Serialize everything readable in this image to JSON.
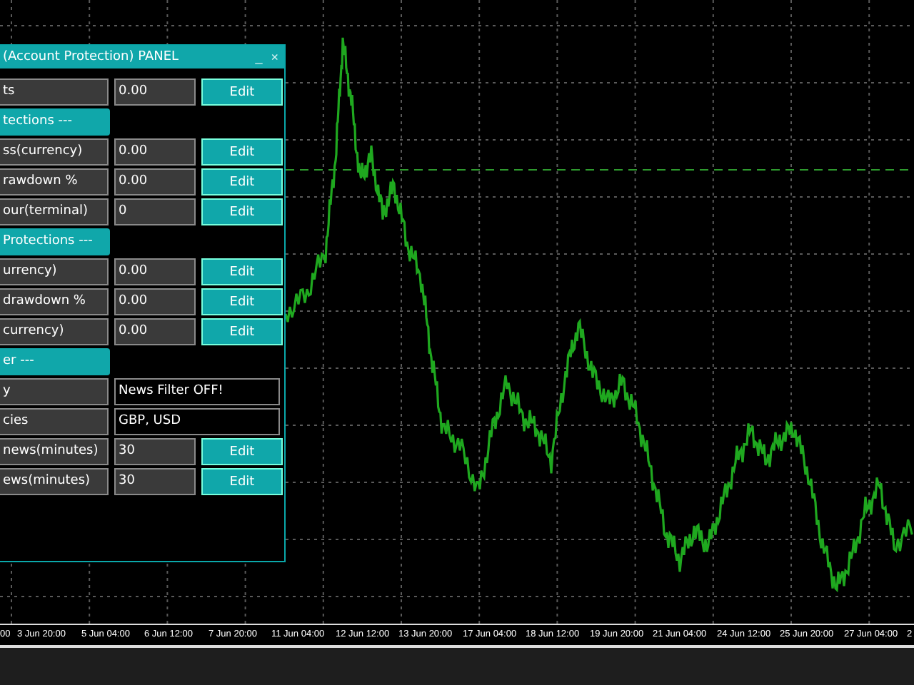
{
  "panel": {
    "title": "(Account Protection) PANEL",
    "minimize": "_",
    "close": "×",
    "rows": [
      {
        "kind": "edit",
        "label": "ts",
        "value": "0.00",
        "button": "Edit"
      },
      {
        "kind": "header",
        "label": "tections ---"
      },
      {
        "kind": "edit",
        "label": "ss(currency)",
        "value": "0.00",
        "button": "Edit"
      },
      {
        "kind": "edit",
        "label": "rawdown %",
        "value": "0.00",
        "button": "Edit"
      },
      {
        "kind": "edit",
        "label": "our(terminal)",
        "value": "0",
        "button": "Edit"
      },
      {
        "kind": "header",
        "label": "Protections ---"
      },
      {
        "kind": "edit",
        "label": "urrency)",
        "value": "0.00",
        "button": "Edit"
      },
      {
        "kind": "edit",
        "label": "drawdown %",
        "value": "0.00",
        "button": "Edit"
      },
      {
        "kind": "edit",
        "label": "currency)",
        "value": "0.00",
        "button": "Edit"
      },
      {
        "kind": "header",
        "label": "er ---"
      },
      {
        "kind": "text",
        "label": "y",
        "value": "News Filter OFF!"
      },
      {
        "kind": "text",
        "label": "cies",
        "value": "GBP, USD"
      },
      {
        "kind": "edit",
        "label": "news(minutes)",
        "value": "30",
        "button": "Edit"
      },
      {
        "kind": "edit",
        "label": "ews(minutes)",
        "value": "30",
        "button": "Edit"
      }
    ]
  },
  "time_axis": [
    "00",
    "3 Jun 20:00",
    "5 Jun 04:00",
    "6 Jun 12:00",
    "7 Jun 20:00",
    "11 Jun 04:00",
    "12 Jun 12:00",
    "13 Jun 20:00",
    "17 Jun 04:00",
    "18 Jun 12:00",
    "19 Jun 20:00",
    "21 Jun 04:00",
    "24 Jun 12:00",
    "25 Jun 20:00",
    "27 Jun 04:00",
    "2"
  ]
}
